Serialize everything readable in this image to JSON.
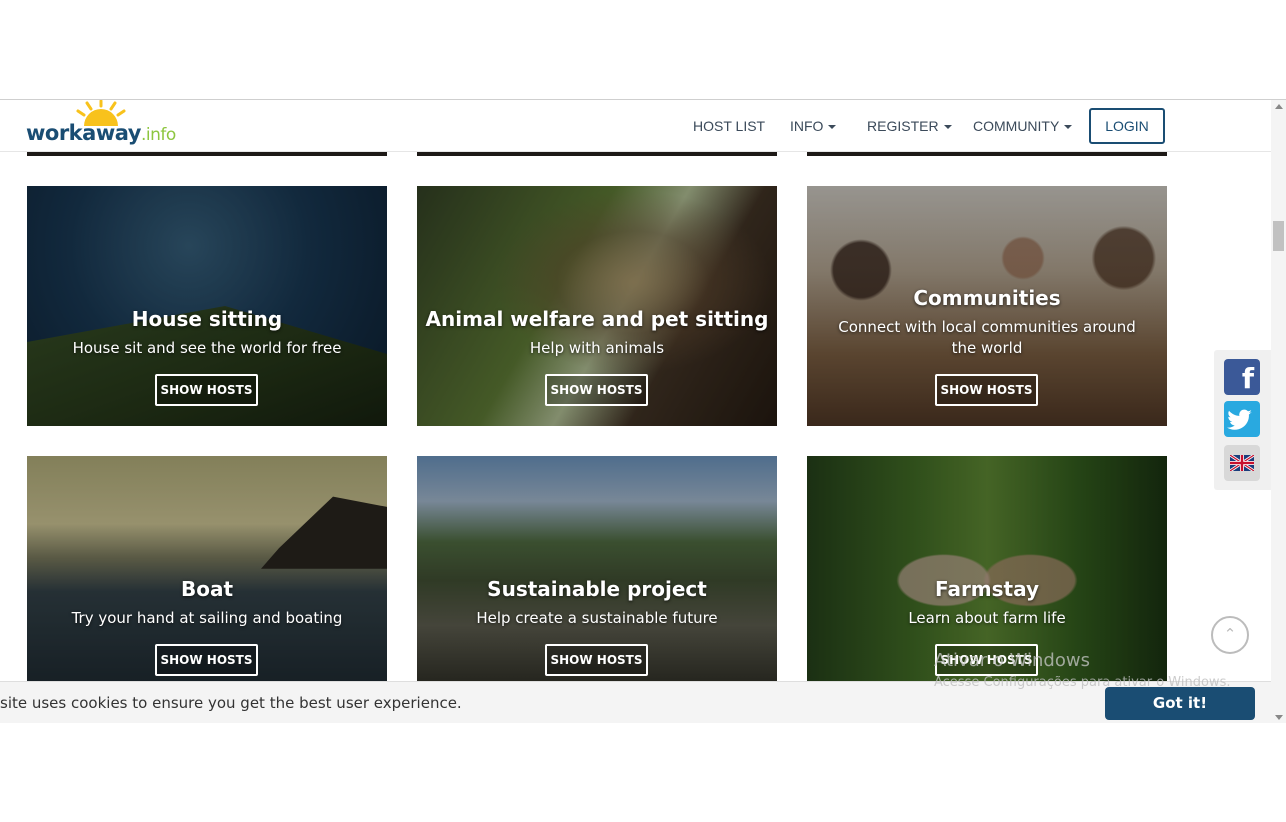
{
  "header": {
    "logo_main": "workaway",
    "logo_ext": ".info",
    "nav": [
      "HOST LIST",
      "INFO",
      "REGISTER",
      "COMMUNITY"
    ],
    "login": "LOGIN"
  },
  "cards": [
    {
      "title": "House sitting",
      "subtitle": "House sit and see the world for free",
      "button": "SHOW HOSTS"
    },
    {
      "title": "Animal welfare and pet sitting",
      "subtitle": "Help with animals",
      "button": "SHOW HOSTS"
    },
    {
      "title": "Communities",
      "subtitle": "Connect with local communities around the world",
      "button": "SHOW HOSTS"
    },
    {
      "title": "Boat",
      "subtitle": "Try your hand at sailing and boating",
      "button": "SHOW HOSTS"
    },
    {
      "title": "Sustainable project",
      "subtitle": "Help create a sustainable future",
      "button": "SHOW HOSTS"
    },
    {
      "title": "Farmstay",
      "subtitle": "Learn about farm life",
      "button": "SHOW HOSTS"
    }
  ],
  "social": {
    "facebook": "f",
    "twitter": "t",
    "language": "UK"
  },
  "cookie": {
    "text": "site uses cookies to ensure you get the best user experience.",
    "button": "Got it!"
  },
  "watermark": {
    "line1": "Ativar o Windows",
    "line2": "Acesse Configurações para ativar o Windows."
  },
  "icons": [
    "sun-logo-icon",
    "caret-down-icon",
    "facebook-icon",
    "twitter-icon",
    "uk-flag-icon",
    "scroll-up-icon"
  ]
}
